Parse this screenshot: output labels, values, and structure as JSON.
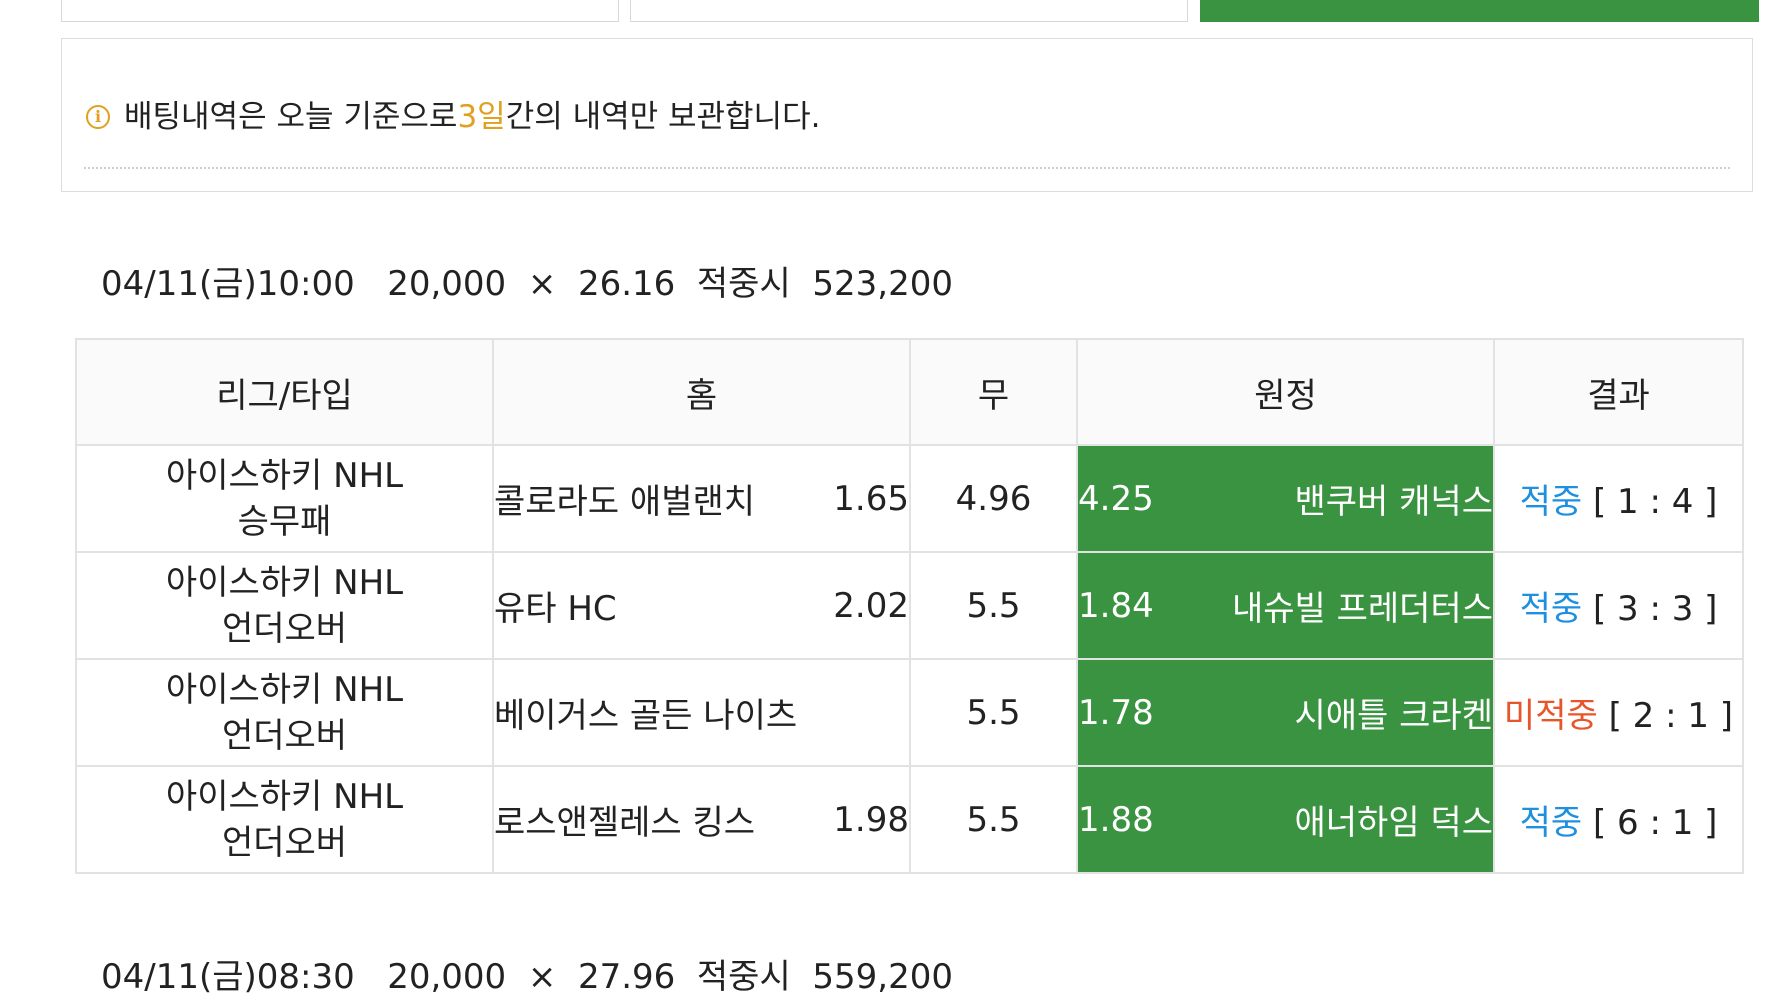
{
  "notice": {
    "text_before": "배팅내역은 오늘 기준으로 ",
    "highlight": "3일",
    "text_after": "간의 내역만 보관합니다."
  },
  "bets": [
    {
      "datetime": "04/11(금)10:00",
      "stake": "20,000",
      "times": "×",
      "odds": "26.16",
      "win_label": "적중시",
      "payout": "523,200"
    },
    {
      "datetime": "04/11(금)08:30",
      "stake": "20,000",
      "times": "×",
      "odds": "27.96",
      "win_label": "적중시",
      "payout": "559,200"
    }
  ],
  "table": {
    "headers": [
      "리그/타입",
      "홈",
      "무",
      "원정",
      "결과"
    ],
    "rows": [
      {
        "league": "아이스하키 NHL",
        "type": "승무패",
        "home_team": "콜로라도 애벌랜치",
        "home_odds": "1.65",
        "draw": "4.96",
        "away_odds": "4.25",
        "away_team": "밴쿠버 캐넉스",
        "result": "적중",
        "score": "[ 1 : 4 ]"
      },
      {
        "league": "아이스하키 NHL",
        "type": "언더오버",
        "home_team": "유타 HC",
        "home_odds": "2.02",
        "draw": "5.5",
        "away_odds": "1.84",
        "away_team": "내슈빌 프레더터스",
        "result": "적중",
        "score": "[ 3 : 3 ]"
      },
      {
        "league": "아이스하키 NHL",
        "type": "언더오버",
        "home_team": "베이거스 골든 나이츠",
        "home_odds": "",
        "draw": "5.5",
        "away_odds": "1.78",
        "away_team": "시애틀 크라켄",
        "result": "미적중",
        "score": "[ 2 : 1 ]"
      },
      {
        "league": "아이스하키 NHL",
        "type": "언더오버",
        "home_team": "로스앤젤레스 킹스",
        "home_odds": "1.98",
        "draw": "5.5",
        "away_odds": "1.88",
        "away_team": "애너하임 덕스",
        "result": "적중",
        "score": "[ 6 : 1 ]"
      }
    ]
  },
  "colors": {
    "accent_green": "#3a9340",
    "hit": "#1e90e0",
    "miss": "#e8552a",
    "notice_highlight": "#e0a020"
  }
}
